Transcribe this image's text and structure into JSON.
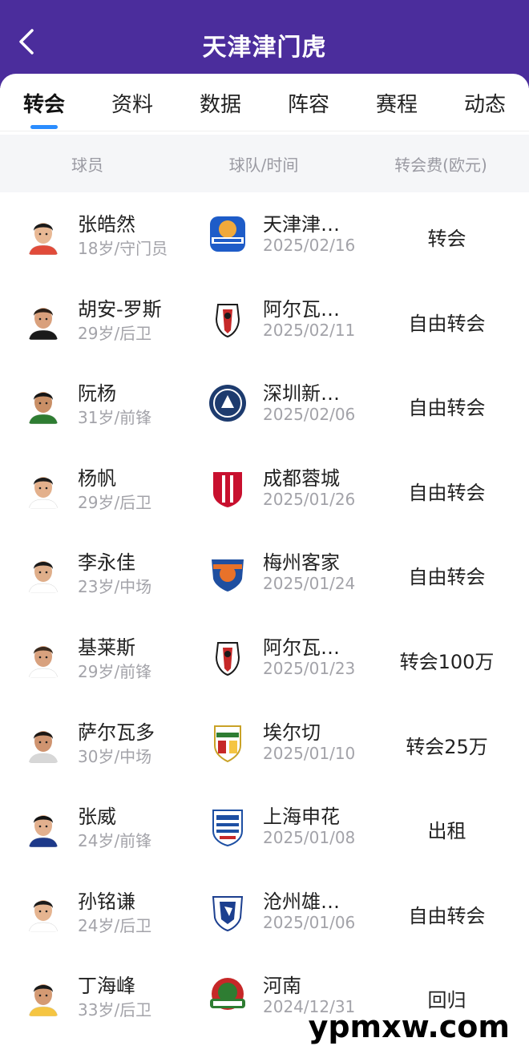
{
  "header": {
    "title": "天津津门虎",
    "back_icon": "chevron-left-icon"
  },
  "tabs": [
    {
      "label": "转会",
      "active": true
    },
    {
      "label": "资料",
      "active": false
    },
    {
      "label": "数据",
      "active": false
    },
    {
      "label": "阵容",
      "active": false
    },
    {
      "label": "赛程",
      "active": false
    },
    {
      "label": "动态",
      "active": false
    }
  ],
  "columns": {
    "player": "球员",
    "team_time": "球队/时间",
    "fee": "转会费(欧元)"
  },
  "transfers": [
    {
      "name": "张皓然",
      "info": "18岁/守门员",
      "team": "天津津…",
      "date": "2025/02/16",
      "fee": "转会",
      "logo": "tianjin-tiger-logo"
    },
    {
      "name": "胡安-罗斯",
      "info": "29岁/后卫",
      "team": "阿尔瓦…",
      "date": "2025/02/11",
      "fee": "自由转会",
      "logo": "albacete-logo"
    },
    {
      "name": "阮杨",
      "info": "31岁/前锋",
      "team": "深圳新…",
      "date": "2025/02/06",
      "fee": "自由转会",
      "logo": "shenzhen-peng-city-logo"
    },
    {
      "name": "杨帆",
      "info": "29岁/后卫",
      "team": "成都蓉城",
      "date": "2025/01/26",
      "fee": "自由转会",
      "logo": "chengdu-rongcheng-logo"
    },
    {
      "name": "李永佳",
      "info": "23岁/中场",
      "team": "梅州客家",
      "date": "2025/01/24",
      "fee": "自由转会",
      "logo": "meizhou-hakka-logo"
    },
    {
      "name": "基莱斯",
      "info": "29岁/前锋",
      "team": "阿尔瓦…",
      "date": "2025/01/23",
      "fee": "转会100万",
      "logo": "albacete-logo"
    },
    {
      "name": "萨尔瓦多",
      "info": "30岁/中场",
      "team": "埃尔切",
      "date": "2025/01/10",
      "fee": "转会25万",
      "logo": "elche-logo"
    },
    {
      "name": "张威",
      "info": "24岁/前锋",
      "team": "上海申花",
      "date": "2025/01/08",
      "fee": "出租",
      "logo": "shanghai-shenhua-logo"
    },
    {
      "name": "孙铭谦",
      "info": "24岁/后卫",
      "team": "沧州雄…",
      "date": "2025/01/06",
      "fee": "自由转会",
      "logo": "cangzhou-lions-logo"
    },
    {
      "name": "丁海峰",
      "info": "33岁/后卫",
      "team": "河南",
      "date": "2024/12/31",
      "fee": "回归",
      "logo": "henan-logo"
    }
  ],
  "watermark": "ypmxw.com",
  "colors": {
    "header_bg": "#4b2d9c",
    "tab_accent": "#2a8dff",
    "column_header_bg": "#f5f6f8",
    "muted_text": "#a3a3a9"
  }
}
